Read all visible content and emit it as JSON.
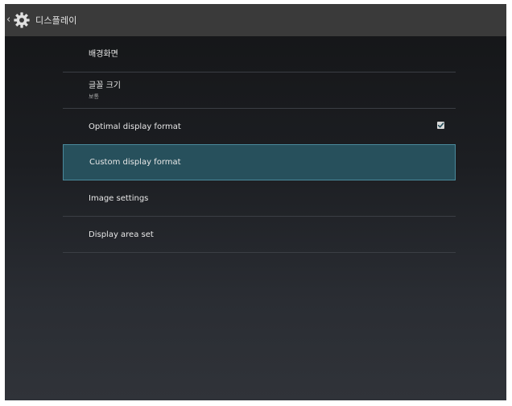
{
  "action_bar": {
    "title": "디스플레이",
    "back_icon": "chevron-left-icon",
    "app_icon": "gear-icon"
  },
  "settings": {
    "items": [
      {
        "label": "배경화면",
        "summary": ""
      },
      {
        "label": "글꼴 크기",
        "summary": "보통"
      },
      {
        "label": "Optimal display format",
        "summary": "",
        "checked": true
      },
      {
        "label": "Custom display format",
        "summary": "",
        "selected": true
      },
      {
        "label": "Image settings",
        "summary": ""
      },
      {
        "label": "Display area set",
        "summary": ""
      }
    ]
  },
  "colors": {
    "action_bar_bg": "#3a3a3a",
    "selected_bg": "#27505c",
    "selected_border": "#4a8a9c"
  }
}
